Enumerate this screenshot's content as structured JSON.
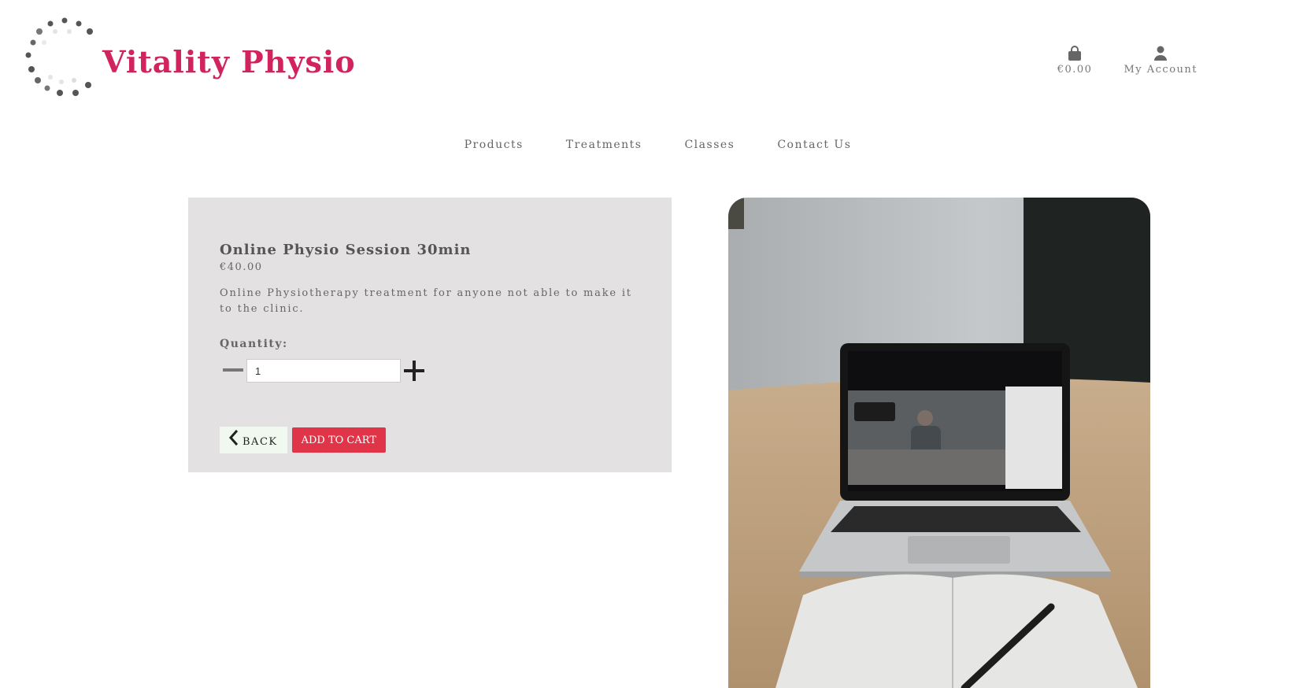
{
  "brand": {
    "name": "Vitality Physio",
    "color": "#d1245f"
  },
  "header": {
    "cart_total": "€0.00",
    "cart_icon": "shopping-bag-icon",
    "account_label": "My Account",
    "account_icon": "user-icon"
  },
  "nav": {
    "items": [
      {
        "label": "Products"
      },
      {
        "label": "Treatments"
      },
      {
        "label": "Classes"
      },
      {
        "label": "Contact Us"
      }
    ]
  },
  "product": {
    "title": "Online Physio Session 30min",
    "price": "€40.00",
    "description": "Online Physiotherapy treatment for anyone not able to make it to the clinic.",
    "quantity_label": "Quantity:",
    "quantity_value": "1",
    "back_label": "BACK",
    "add_to_cart_label": "ADD TO CART",
    "image_icon": "laptop-video-call-photo"
  },
  "colors": {
    "card_bg": "#e3e1e1",
    "add_to_cart": "#e03548",
    "back_bg": "#f0f8ef"
  }
}
